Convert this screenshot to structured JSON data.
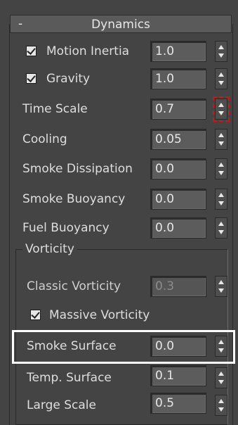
{
  "rollout": {
    "title": "Dynamics",
    "collapse_symbol": "-"
  },
  "params": [
    {
      "label": "Motion Inertia",
      "value": "1.0",
      "checked": true
    },
    {
      "label": "Gravity",
      "value": "1.0",
      "checked": true
    },
    {
      "label": "Time Scale",
      "value": "0.7"
    },
    {
      "label": "Cooling",
      "value": "0.05"
    },
    {
      "label": "Smoke Dissipation",
      "value": "0.0"
    },
    {
      "label": "Smoke Buoyancy",
      "value": "0.0"
    },
    {
      "label": "Fuel Buoyancy",
      "value": "0.0"
    }
  ],
  "vorticity": {
    "group_title": "Vorticity",
    "classic": {
      "label": "Classic Vorticity",
      "value": "0.3"
    },
    "massive": {
      "label": "Massive Vorticity",
      "checked": true
    },
    "smoke_surface": {
      "label": "Smoke Surface",
      "value": "0.0"
    },
    "temp_surface": {
      "label": "Temp. Surface",
      "value": "0.1"
    },
    "large_scale": {
      "label": "Large Scale",
      "value": "0.5"
    }
  },
  "colors": {
    "panel_bg": "#444444",
    "field_bg": "#5c5c5c",
    "active_spinner_outline": "#c81818",
    "highlight_box": "#ffffff"
  },
  "icons": {
    "spinner": "up-down-spinner-icon",
    "checkbox": "checkmark-icon"
  }
}
